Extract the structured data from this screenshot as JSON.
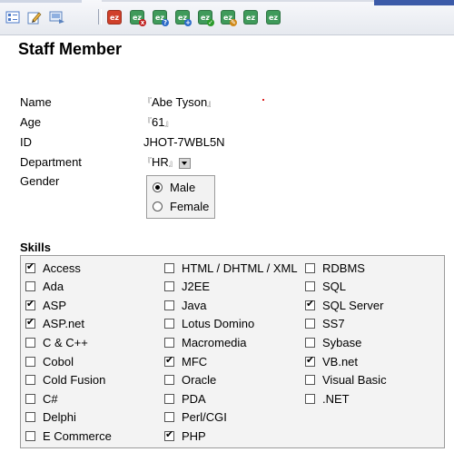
{
  "toolbar": {
    "left_icons": [
      {
        "name": "form-view-icon",
        "color": "#4a78c8"
      },
      {
        "name": "edit-icon",
        "color": "#3a8a3a"
      },
      {
        "name": "print-icon",
        "color": "#5b83bf"
      }
    ],
    "ez_icons": [
      {
        "name": "ez-icon-1",
        "color": "#d0402a",
        "mark": "",
        "mark_color": ""
      },
      {
        "name": "ez-icon-2",
        "color": "#3f9a5a",
        "mark": "x",
        "mark_color": "#c02020"
      },
      {
        "name": "ez-icon-3",
        "color": "#3f9a5a",
        "mark": "?",
        "mark_color": "#2a6ac8"
      },
      {
        "name": "ez-icon-4",
        "color": "#3f9a5a",
        "mark": "+",
        "mark_color": "#2a6ac8"
      },
      {
        "name": "ez-icon-5",
        "color": "#3f9a5a",
        "mark": "✓",
        "mark_color": "#2a9a2a"
      },
      {
        "name": "ez-icon-6",
        "color": "#3f9a5a",
        "mark": "✎",
        "mark_color": "#d08a1a"
      },
      {
        "name": "ez-icon-7",
        "color": "#3f9a5a",
        "mark": "",
        "mark_color": ""
      },
      {
        "name": "ez-icon-8",
        "color": "#3f9a5a",
        "mark": "",
        "mark_color": ""
      }
    ],
    "ez_label": "ez"
  },
  "page": {
    "title": "Staff Member"
  },
  "form": {
    "name_label": "Name",
    "name_value": "Abe Tyson",
    "age_label": "Age",
    "age_value": "61",
    "id_label": "ID",
    "id_value": "JHOT-7WBL5N",
    "department_label": "Department",
    "department_value": "HR",
    "gender_label": "Gender",
    "gender_options": [
      "Male",
      "Female"
    ],
    "gender_selected": "Male"
  },
  "skills": {
    "title": "Skills",
    "columns": [
      [
        {
          "label": "Access",
          "checked": true
        },
        {
          "label": "Ada",
          "checked": false
        },
        {
          "label": "ASP",
          "checked": true
        },
        {
          "label": "ASP.net",
          "checked": true
        },
        {
          "label": "C & C++",
          "checked": false
        },
        {
          "label": "Cobol",
          "checked": false
        },
        {
          "label": "Cold Fusion",
          "checked": false
        },
        {
          "label": "C#",
          "checked": false
        },
        {
          "label": "Delphi",
          "checked": false
        },
        {
          "label": "E Commerce",
          "checked": false
        }
      ],
      [
        {
          "label": "HTML / DHTML / XML",
          "checked": false
        },
        {
          "label": "J2EE",
          "checked": false
        },
        {
          "label": "Java",
          "checked": false
        },
        {
          "label": "Lotus Domino",
          "checked": false
        },
        {
          "label": "Macromedia",
          "checked": false
        },
        {
          "label": "MFC",
          "checked": true
        },
        {
          "label": "Oracle",
          "checked": false
        },
        {
          "label": "PDA",
          "checked": false
        },
        {
          "label": "Perl/CGI",
          "checked": false
        },
        {
          "label": "PHP",
          "checked": true
        }
      ],
      [
        {
          "label": "RDBMS",
          "checked": false
        },
        {
          "label": "SQL",
          "checked": false
        },
        {
          "label": "SQL Server",
          "checked": true
        },
        {
          "label": "SS7",
          "checked": false
        },
        {
          "label": "Sybase",
          "checked": false
        },
        {
          "label": "VB.net",
          "checked": true
        },
        {
          "label": "Visual Basic",
          "checked": false
        },
        {
          "label": ".NET",
          "checked": false
        }
      ]
    ]
  }
}
